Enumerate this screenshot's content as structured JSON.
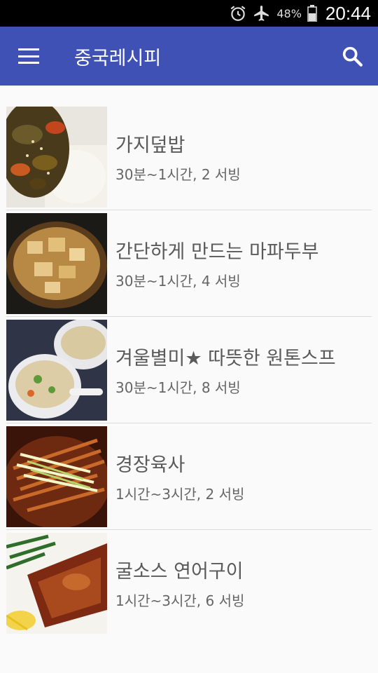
{
  "status": {
    "battery_pct": "48%",
    "time": "20:44"
  },
  "app_bar": {
    "title": "중국레시피"
  },
  "recipes": [
    {
      "name": "가지덮밥",
      "meta": "30분~1시간, 2 서빙"
    },
    {
      "name": "간단하게 만드는 마파두부",
      "meta": "30분~1시간, 4 서빙"
    },
    {
      "name": "겨울별미★ 따뜻한 원톤스프",
      "meta": "30분~1시간, 8 서빙"
    },
    {
      "name": "경장육사",
      "meta": "1시간~3시간, 2 서빙"
    },
    {
      "name": "굴소스 연어구이",
      "meta": "1시간~3시간, 6 서빙"
    }
  ],
  "colors": {
    "app_bar": "#3f51b5",
    "background": "#fafafa"
  }
}
